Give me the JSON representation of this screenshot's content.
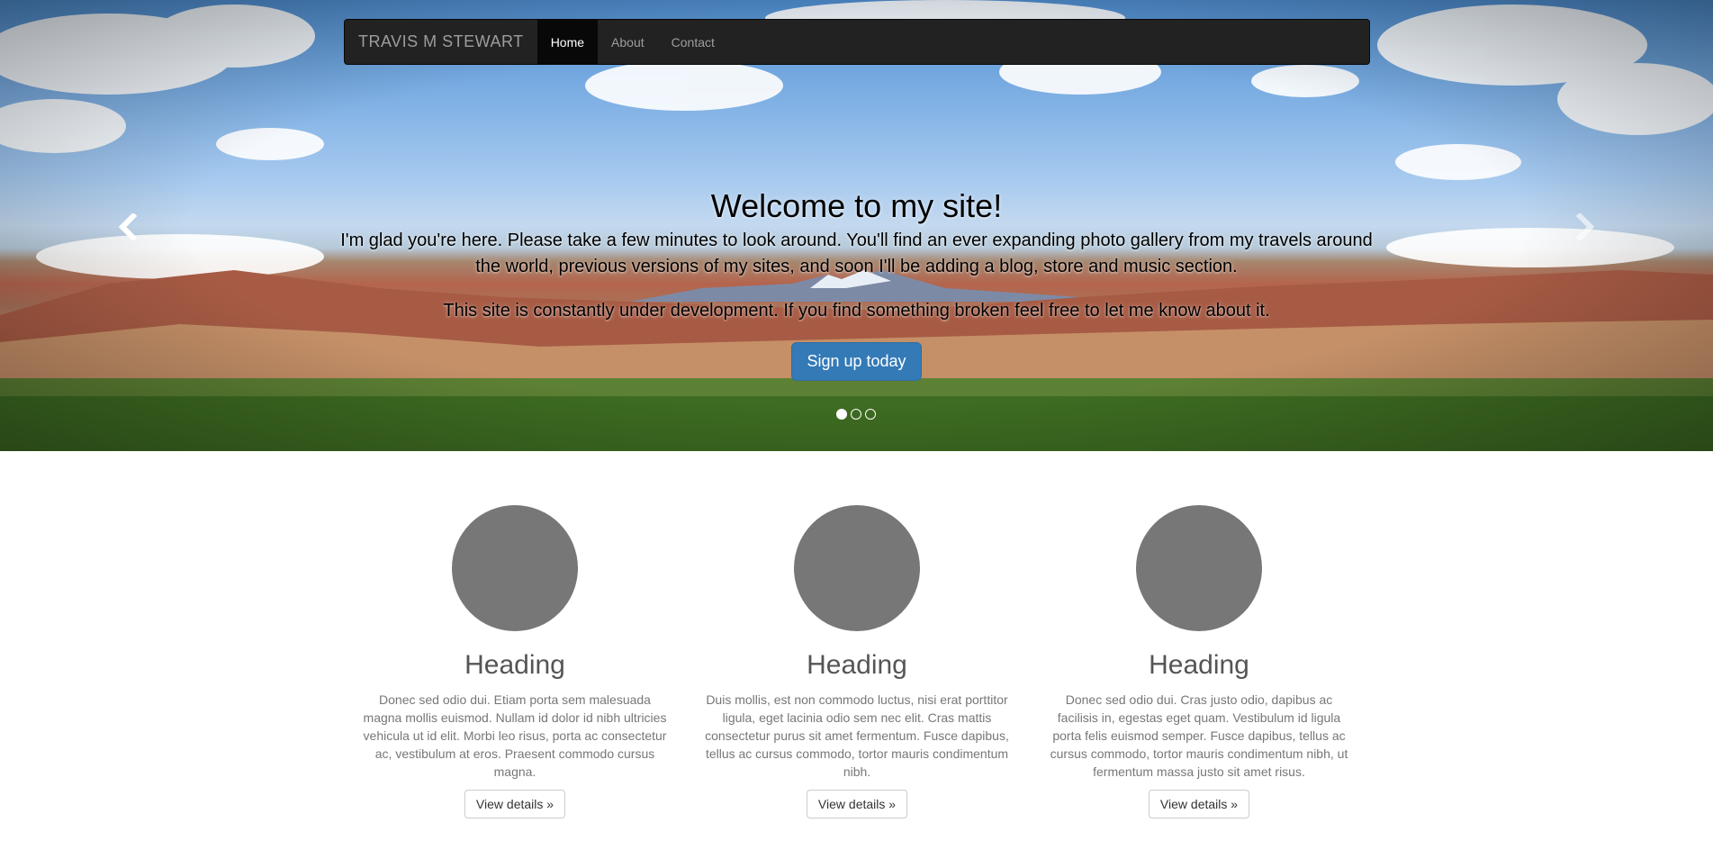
{
  "navbar": {
    "brand": "TRAVIS M STEWART",
    "items": [
      {
        "label": "Home",
        "active": true
      },
      {
        "label": "About",
        "active": false
      },
      {
        "label": "Contact",
        "active": false
      }
    ]
  },
  "carousel": {
    "title": "Welcome to my site!",
    "text1": "I'm glad you're here. Please take a few minutes to look around. You'll find an ever expanding photo gallery from my travels around the world, previous versions of my sites, and soon I'll be adding a blog, store and music section.",
    "text2": "This site is constantly under development. If you find something broken feel free to let me know about it.",
    "button": "Sign up today",
    "prev_icon": "chevron-left-icon",
    "next_icon": "chevron-right-icon",
    "slide_count": 3,
    "active_slide": 1
  },
  "columns": [
    {
      "heading": "Heading",
      "text": "Donec sed odio dui. Etiam porta sem malesuada magna mollis euismod. Nullam id dolor id nibh ultricies vehicula ut id elit. Morbi leo risus, porta ac consectetur ac, vestibulum at eros. Praesent commodo cursus magna.",
      "button": "View details »"
    },
    {
      "heading": "Heading",
      "text": "Duis mollis, est non commodo luctus, nisi erat porttitor ligula, eget lacinia odio sem nec elit. Cras mattis consectetur purus sit amet fermentum. Fusce dapibus, tellus ac cursus commodo, tortor mauris condimentum nibh.",
      "button": "View details »"
    },
    {
      "heading": "Heading",
      "text": "Donec sed odio dui. Cras justo odio, dapibus ac facilisis in, egestas eget quam. Vestibulum id ligula porta felis euismod semper. Fusce dapibus, tellus ac cursus commodo, tortor mauris condimentum nibh, ut fermentum massa justo sit amet risus.",
      "button": "View details »"
    }
  ],
  "colors": {
    "navbar_bg": "#222222",
    "primary_button": "#337ab7",
    "placeholder_circle": "#777777"
  }
}
